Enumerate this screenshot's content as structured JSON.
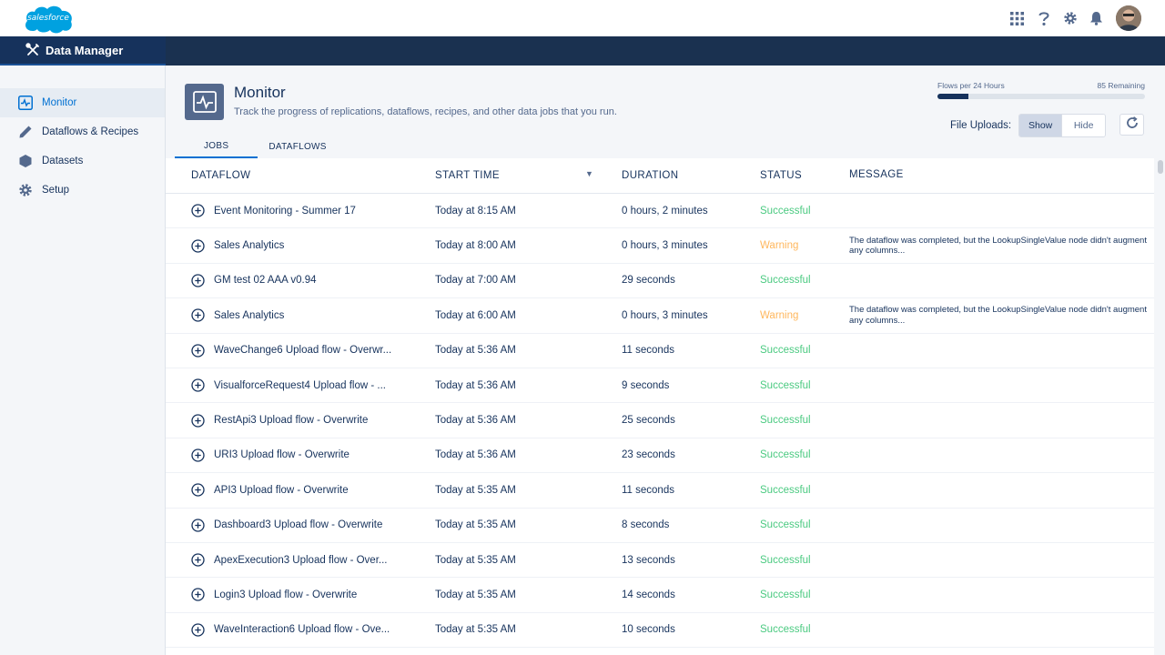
{
  "brand": {
    "logo_text": "salesforce",
    "accent": "#0070d2",
    "header_dark": "#16325c"
  },
  "header": {
    "icons": [
      "app-launcher-icon",
      "help-icon",
      "gear-icon",
      "bell-icon"
    ]
  },
  "app": {
    "title": "Data Manager"
  },
  "sidebar": {
    "items": [
      {
        "label": "Monitor",
        "icon": "monitor-icon",
        "active": true
      },
      {
        "label": "Dataflows & Recipes",
        "icon": "pencil-icon",
        "active": false
      },
      {
        "label": "Datasets",
        "icon": "dataset-icon",
        "active": false
      },
      {
        "label": "Setup",
        "icon": "gear-icon",
        "active": false
      }
    ]
  },
  "page": {
    "title": "Monitor",
    "description": "Track the progress of replications, dataflows, recipes, and other data jobs that you run."
  },
  "quota": {
    "label": "Flows per 24 Hours",
    "remaining": "85 Remaining",
    "used_fraction": 0.15
  },
  "uploads": {
    "label": "File Uploads:",
    "show": "Show",
    "hide": "Hide"
  },
  "tabs": [
    "JOBS",
    "DATAFLOWS"
  ],
  "table": {
    "columns": [
      "DATAFLOW",
      "START TIME",
      "DURATION",
      "STATUS",
      "MESSAGE"
    ],
    "rows": [
      {
        "name": "Event Monitoring - Summer 17",
        "start": "Today at 8:15 AM",
        "duration": "0 hours, 2 minutes",
        "status": "Successful",
        "message": ""
      },
      {
        "name": "Sales Analytics",
        "start": "Today at 8:00 AM",
        "duration": "0 hours, 3 minutes",
        "status": "Warning",
        "message": "The dataflow was completed, but the LookupSingleValue node didn't augment any columns..."
      },
      {
        "name": "GM test 02 AAA v0.94",
        "start": "Today at 7:00 AM",
        "duration": "29 seconds",
        "status": "Successful",
        "message": ""
      },
      {
        "name": "Sales Analytics",
        "start": "Today at 6:00 AM",
        "duration": "0 hours, 3 minutes",
        "status": "Warning",
        "message": "The dataflow was completed, but the LookupSingleValue node didn't augment any columns..."
      },
      {
        "name": "WaveChange6 Upload flow - Overwr...",
        "start": "Today at 5:36 AM",
        "duration": "11 seconds",
        "status": "Successful",
        "message": ""
      },
      {
        "name": "VisualforceRequest4 Upload flow - ...",
        "start": "Today at 5:36 AM",
        "duration": "9 seconds",
        "status": "Successful",
        "message": ""
      },
      {
        "name": "RestApi3 Upload flow - Overwrite",
        "start": "Today at 5:36 AM",
        "duration": "25 seconds",
        "status": "Successful",
        "message": ""
      },
      {
        "name": "URI3 Upload flow - Overwrite",
        "start": "Today at 5:36 AM",
        "duration": "23 seconds",
        "status": "Successful",
        "message": ""
      },
      {
        "name": "API3 Upload flow - Overwrite",
        "start": "Today at 5:35 AM",
        "duration": "11 seconds",
        "status": "Successful",
        "message": ""
      },
      {
        "name": "Dashboard3 Upload flow - Overwrite",
        "start": "Today at 5:35 AM",
        "duration": "8 seconds",
        "status": "Successful",
        "message": ""
      },
      {
        "name": "ApexExecution3 Upload flow - Over...",
        "start": "Today at 5:35 AM",
        "duration": "13 seconds",
        "status": "Successful",
        "message": ""
      },
      {
        "name": "Login3 Upload flow - Overwrite",
        "start": "Today at 5:35 AM",
        "duration": "14 seconds",
        "status": "Successful",
        "message": ""
      },
      {
        "name": "WaveInteraction6 Upload flow - Ove...",
        "start": "Today at 5:35 AM",
        "duration": "10 seconds",
        "status": "Successful",
        "message": ""
      }
    ]
  },
  "status_colors": {
    "Successful": "#4bca81",
    "Warning": "#ffb75d"
  }
}
